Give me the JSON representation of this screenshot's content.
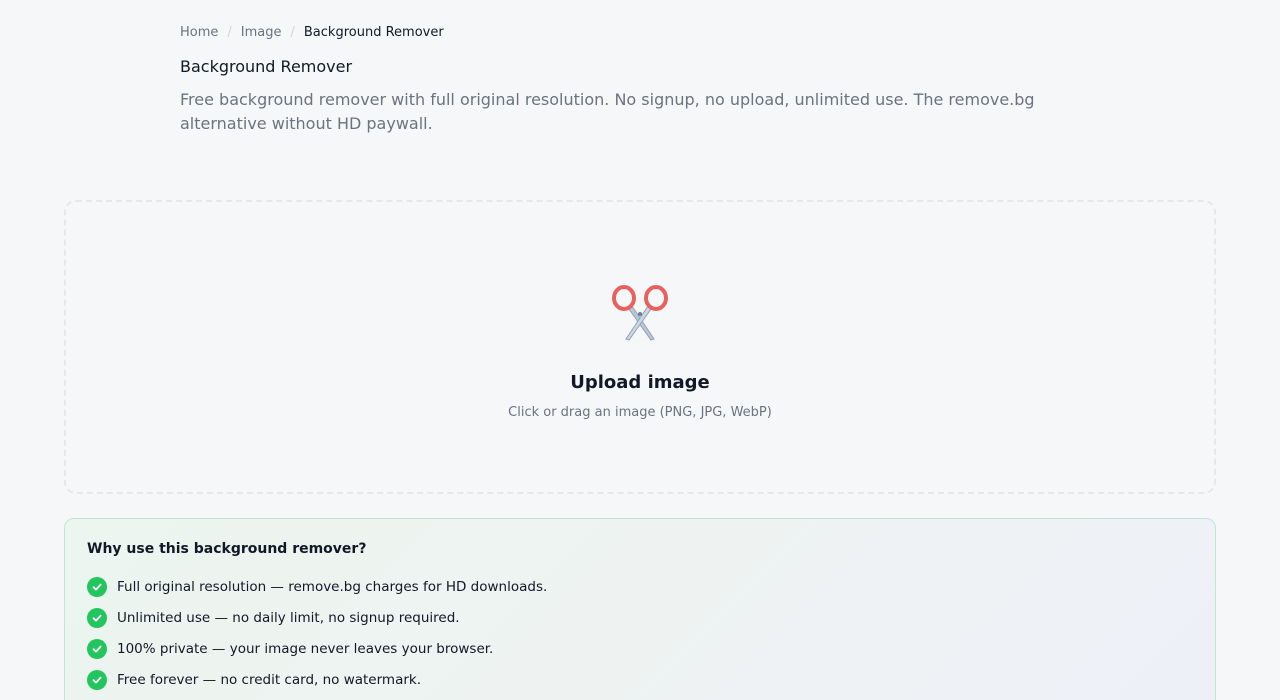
{
  "breadcrumb": {
    "items": [
      {
        "label": "Home"
      },
      {
        "label": "Image"
      },
      {
        "label": "Background Remover"
      }
    ],
    "separator": "/"
  },
  "header": {
    "title": "Background Remover",
    "description": "Free background remover with full original resolution. No signup, no upload, unlimited use. The remove.bg alternative without HD paywall."
  },
  "upload": {
    "icon": "scissors-icon",
    "title": "Upload image",
    "hint": "Click or drag an image (PNG, JPG, WebP)"
  },
  "why": {
    "title": "Why use this background remover?",
    "items": [
      {
        "text": "Full original resolution — remove.bg charges for HD downloads.",
        "icon": "check-icon"
      },
      {
        "text": "Unlimited use — no daily limit, no signup required.",
        "icon": "check-icon"
      },
      {
        "text": "100% private — your image never leaves your browser.",
        "icon": "check-icon"
      },
      {
        "text": "Free forever — no credit card, no watermark.",
        "icon": "check-icon"
      }
    ]
  },
  "colors": {
    "background": "#f6f7f9",
    "accent_green": "#22c55e",
    "muted_text": "#6b7280"
  }
}
